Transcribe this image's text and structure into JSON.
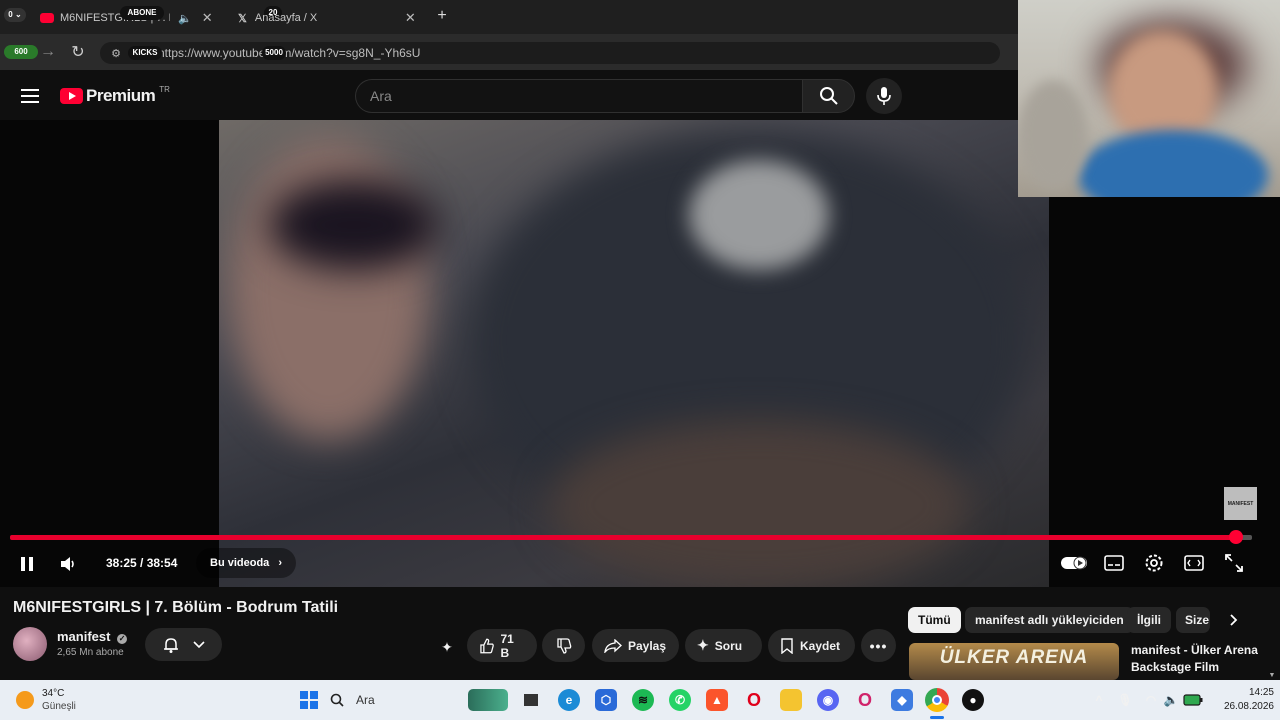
{
  "browser": {
    "tabs": [
      {
        "title": "M6NIFESTGIRLS | 7. Bölüm"
      },
      {
        "title": "Anasayfa / X"
      }
    ],
    "url": "https://www.youtube.com/watch?v=sg8N_-Yh6sU",
    "overlay": {
      "counter_left": "0",
      "abone_label": "ABONE",
      "abone_count": "20",
      "counter_600": "600",
      "kicks_label": "KICKS",
      "kicks_count": "5000"
    }
  },
  "youtube": {
    "logo_text": "Premium",
    "logo_region": "TR",
    "search_placeholder": "Ara"
  },
  "player": {
    "time": "38:25 / 38:54",
    "chapter_label": "Bu videoda",
    "progress": 0.987,
    "watermark": "MANIFEST"
  },
  "video_info": {
    "title": "M6NIFESTGIRLS | 7. Bölüm - Bodrum Tatili",
    "channel": "manifest",
    "subscribers": "2,65 Mn abone",
    "like_count": "71 B",
    "share_label": "Paylaş",
    "ask_label": "Soru",
    "save_label": "Kaydet"
  },
  "sidebar": {
    "chips": [
      "Tümü",
      "manifest adlı yükleyiciden",
      "İlgili",
      "Size"
    ],
    "recommended": {
      "thumb_text": "ÜLKER ARENA",
      "title": "manifest - Ülker Arena Backstage Film"
    }
  },
  "taskbar": {
    "weather_temp": "34°C",
    "weather_desc": "Güneşli",
    "search_label": "Ara",
    "time": "14:25",
    "date": "26.08.2026"
  },
  "colors": {
    "accent": "#ff0033",
    "bg": "#0f0f0f"
  }
}
